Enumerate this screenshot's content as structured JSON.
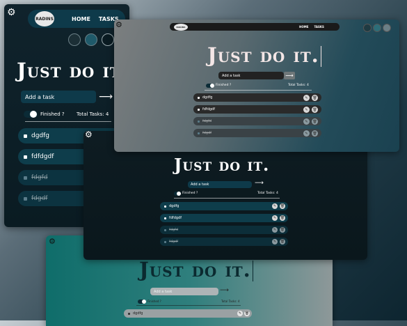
{
  "app": {
    "title": "Just do it.",
    "logo": "RADINS",
    "nav": {
      "home": "HOME",
      "tasks": "TASKS"
    },
    "input_placeholder": "Add a task",
    "finished_label": "Finished ?",
    "total_label": "Total Tasks: 4",
    "tasks": [
      {
        "text": "dgdfg",
        "done": false
      },
      {
        "text": "fdfdgdf",
        "done": false
      },
      {
        "text": "fdgfd",
        "done": true
      },
      {
        "text": "fdgdf",
        "done": true
      }
    ]
  },
  "icons": {
    "submit": "arrow-right-icon",
    "check": "checkbox-icon",
    "edit": "edit-icon",
    "delete": "trash-icon",
    "corner": "gear-icon"
  },
  "colors": {
    "dark": "#0b1f27",
    "teal": "#0e3a4a",
    "row_dark": "#0e3d4b",
    "row_gray": "#2a2a2a",
    "accent": "#1b5c6e"
  }
}
